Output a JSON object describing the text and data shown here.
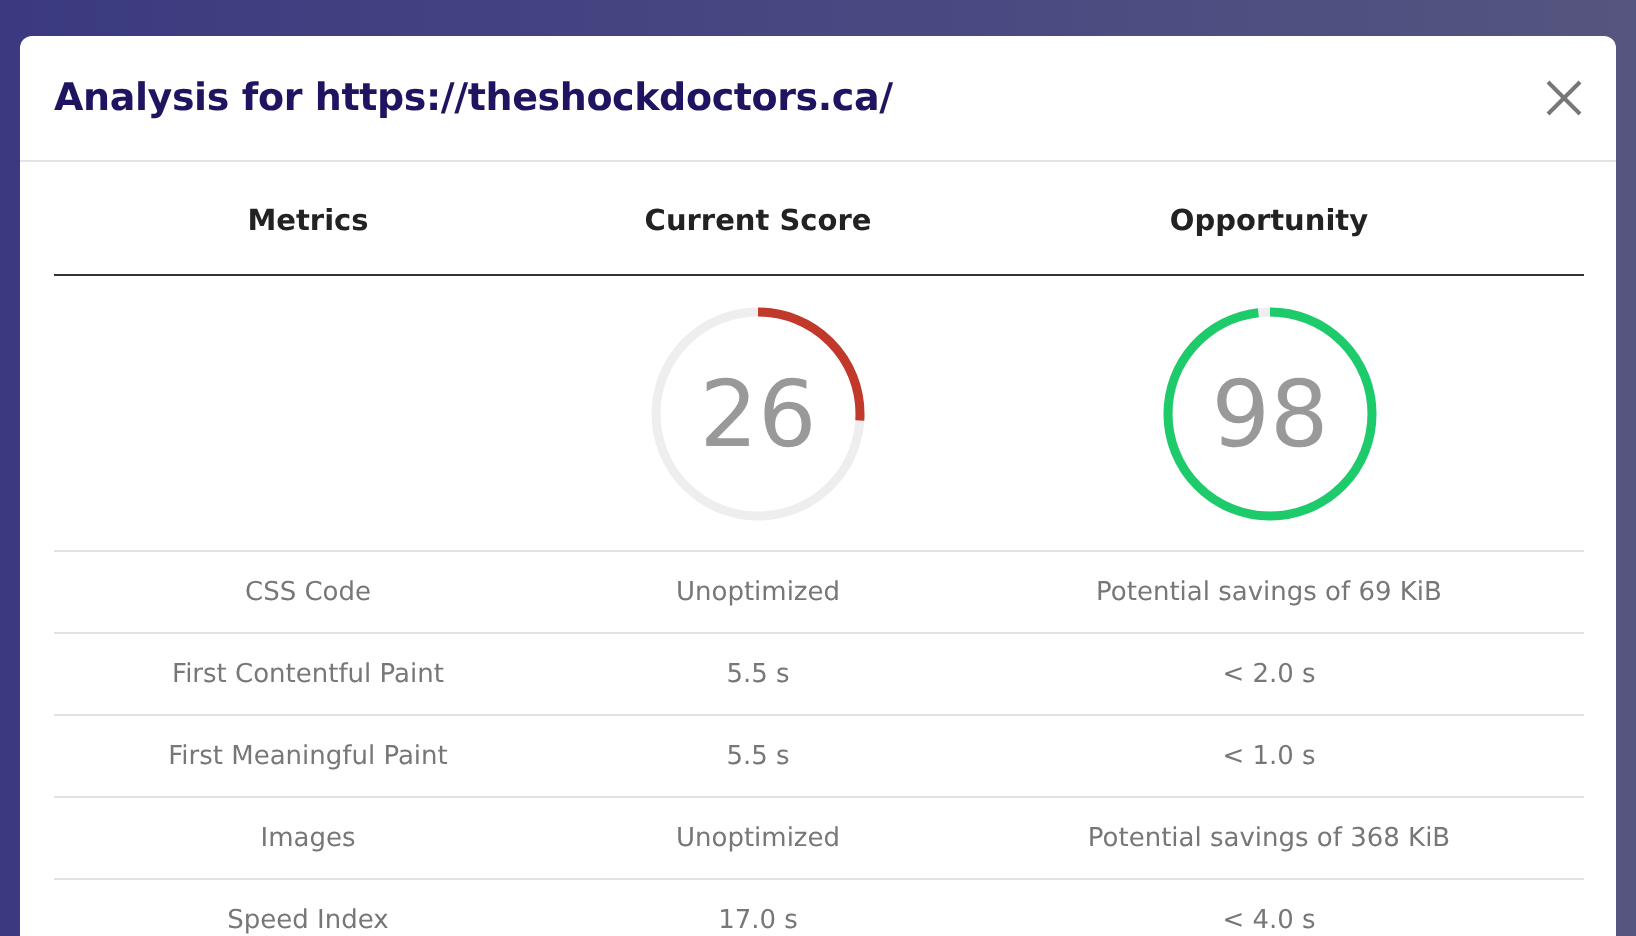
{
  "dialog": {
    "title": "Analysis for https://theshockdoctors.ca/"
  },
  "table": {
    "columns": [
      "Metrics",
      "Current Score",
      "Opportunity"
    ],
    "scores": [
      {
        "value": "26",
        "color": "#c0392b"
      },
      {
        "value": "98",
        "color": "#1ecb6b"
      }
    ],
    "rows": [
      [
        "CSS Code",
        "Unoptimized",
        "Potential savings of 69 KiB"
      ],
      [
        "First Contentful Paint",
        "5.5 s",
        "< 2.0 s"
      ],
      [
        "First Meaningful Paint",
        "5.5 s",
        "< 1.0 s"
      ],
      [
        "Images",
        "Unoptimized",
        "Potential savings of 368 KiB"
      ],
      [
        "Speed Index",
        "17.0 s",
        "< 4.0 s"
      ]
    ]
  }
}
